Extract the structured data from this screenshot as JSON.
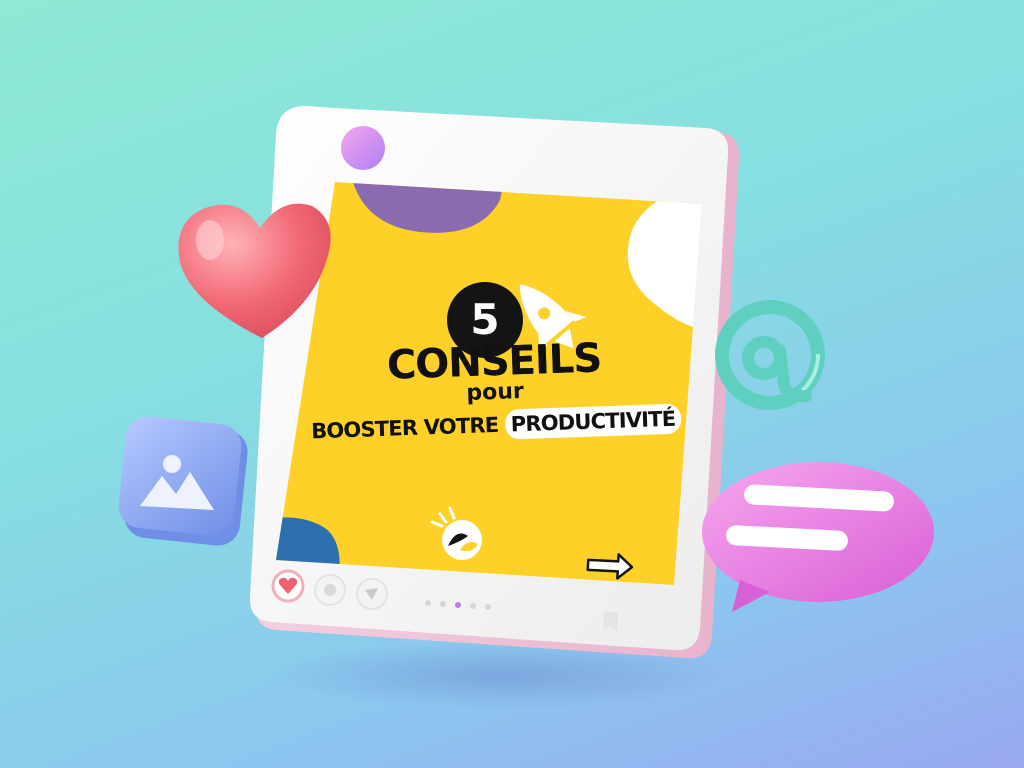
{
  "post": {
    "number": "5",
    "title": "CONSEILS",
    "connector": "pour",
    "subtitle_prefix": "BOOSTER VOTRE ",
    "subtitle_highlight": "PRODUCTIVITÉ",
    "carousel_dots": 5,
    "active_dot": 3
  },
  "icons": {
    "floating_heart": "heart-icon",
    "floating_image": "image-icon",
    "floating_at": "at-sign-icon",
    "floating_chat": "chat-bubble-icon",
    "rocket": "rocket-icon",
    "logo": "brand-logo-icon",
    "next": "arrow-right-icon",
    "like": "heart-icon",
    "comment": "comment-icon",
    "share": "send-icon",
    "save": "bookmark-icon",
    "menu_dot": "profile-dot-icon"
  },
  "colors": {
    "post_background": "#FDD128",
    "blob_purple": "#8A6BB0",
    "blob_blue": "#2E6FB0",
    "badge": "#141414",
    "heart": "#F0606E",
    "chat_bubble": "#E87BE0",
    "at_sign": "#5FD0C0",
    "image_tile": "#8AA8F2",
    "device_frame": "#F7F7F7"
  }
}
